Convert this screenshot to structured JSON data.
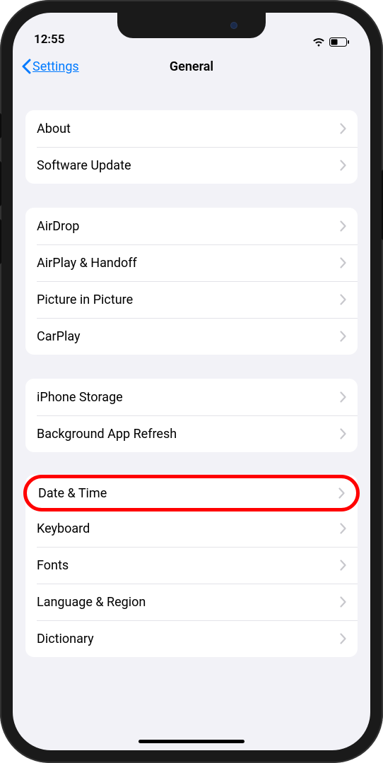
{
  "status": {
    "time": "12:55"
  },
  "nav": {
    "back_label": "Settings",
    "title": "General"
  },
  "groups": [
    {
      "rows": [
        {
          "id": "about",
          "label": "About",
          "highlighted": false
        },
        {
          "id": "software-update",
          "label": "Software Update",
          "highlighted": false
        }
      ]
    },
    {
      "rows": [
        {
          "id": "airdrop",
          "label": "AirDrop",
          "highlighted": false
        },
        {
          "id": "airplay-handoff",
          "label": "AirPlay & Handoff",
          "highlighted": false
        },
        {
          "id": "picture-in-picture",
          "label": "Picture in Picture",
          "highlighted": false
        },
        {
          "id": "carplay",
          "label": "CarPlay",
          "highlighted": false
        }
      ]
    },
    {
      "rows": [
        {
          "id": "iphone-storage",
          "label": "iPhone Storage",
          "highlighted": false
        },
        {
          "id": "background-app-refresh",
          "label": "Background App Refresh",
          "highlighted": false
        }
      ]
    },
    {
      "rows": [
        {
          "id": "date-time",
          "label": "Date & Time",
          "highlighted": true
        },
        {
          "id": "keyboard",
          "label": "Keyboard",
          "highlighted": false
        },
        {
          "id": "fonts",
          "label": "Fonts",
          "highlighted": false
        },
        {
          "id": "language-region",
          "label": "Language & Region",
          "highlighted": false
        },
        {
          "id": "dictionary",
          "label": "Dictionary",
          "highlighted": false
        }
      ]
    }
  ]
}
